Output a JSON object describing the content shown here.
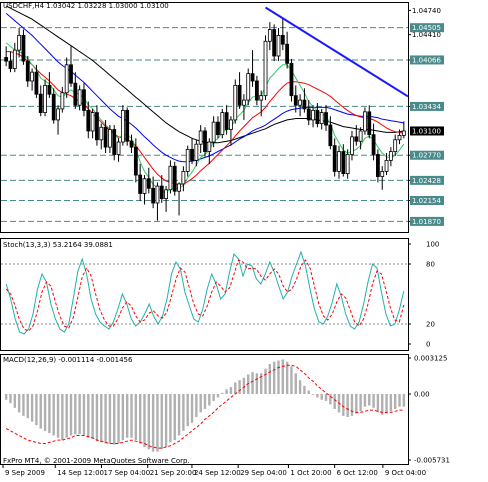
{
  "main_chart": {
    "header": "USDCHF,H4  1.03042 1.03228 1.03000 1.03100",
    "price_ticks": [
      "1.04740",
      "1.04410",
      "1.04066",
      "1.03434",
      "1.02770",
      "1.02428",
      "1.02154",
      "1.01870"
    ],
    "price_labels": [
      "1.04505",
      "1.04066",
      "1.03434",
      "1.03100",
      "1.02770",
      "1.02428",
      "1.02154",
      "1.01870"
    ],
    "current_price": "1.03100",
    "price_range": [
      1.0178,
      1.048
    ],
    "hlines": [
      1.04505,
      1.04066,
      1.03434,
      1.0277,
      1.02428,
      1.02154,
      1.0187
    ],
    "trendline": {
      "from_bar": 60,
      "from_price": 1.0478,
      "to_bar": 98,
      "to_price": 1.0366
    },
    "candles": [
      [
        1.041,
        1.0425,
        1.0398,
        1.0405
      ],
      [
        1.0405,
        1.0418,
        1.039,
        1.0395
      ],
      [
        1.0395,
        1.043,
        1.039,
        1.042
      ],
      [
        1.042,
        1.045,
        1.041,
        1.044
      ],
      [
        1.044,
        1.0448,
        1.04,
        1.0405
      ],
      [
        1.0405,
        1.0412,
        1.037,
        1.0378
      ],
      [
        1.0378,
        1.0395,
        1.0365,
        1.039
      ],
      [
        1.039,
        1.04,
        1.0355,
        1.036
      ],
      [
        1.036,
        1.0372,
        1.033,
        1.0335
      ],
      [
        1.0335,
        1.038,
        1.033,
        1.0372
      ],
      [
        1.0372,
        1.039,
        1.0355,
        1.036
      ],
      [
        1.036,
        1.0368,
        1.032,
        1.0325
      ],
      [
        1.0325,
        1.0345,
        1.0305,
        1.034
      ],
      [
        1.034,
        1.037,
        1.0335,
        1.0362
      ],
      [
        1.0362,
        1.041,
        1.0355,
        1.04
      ],
      [
        1.04,
        1.0425,
        1.037,
        1.0375
      ],
      [
        1.0375,
        1.039,
        1.034,
        1.0345
      ],
      [
        1.0345,
        1.0372,
        1.0338,
        1.0366
      ],
      [
        1.0366,
        1.0375,
        1.033,
        1.0338
      ],
      [
        1.0338,
        1.035,
        1.03,
        1.031
      ],
      [
        1.031,
        1.034,
        1.03,
        1.0335
      ],
      [
        1.0335,
        1.0345,
        1.029,
        1.0298
      ],
      [
        1.0298,
        1.032,
        1.0285,
        1.0315
      ],
      [
        1.0315,
        1.0325,
        1.028,
        1.0288
      ],
      [
        1.0288,
        1.0318,
        1.028,
        1.0312
      ],
      [
        1.0312,
        1.0318,
        1.027,
        1.0278
      ],
      [
        1.0278,
        1.03,
        1.0268,
        1.0295
      ],
      [
        1.0295,
        1.0345,
        1.029,
        1.0338
      ],
      [
        1.0338,
        1.0342,
        1.029,
        1.0296
      ],
      [
        1.0296,
        1.0305,
        1.028,
        1.0288
      ],
      [
        1.0288,
        1.03,
        1.024,
        1.025
      ],
      [
        1.025,
        1.0265,
        1.0215,
        1.0225
      ],
      [
        1.0225,
        1.025,
        1.021,
        1.0245
      ],
      [
        1.0245,
        1.026,
        1.0225,
        1.0232
      ],
      [
        1.0232,
        1.0248,
        1.0205,
        1.0212
      ],
      [
        1.0212,
        1.024,
        1.0188,
        1.0235
      ],
      [
        1.0235,
        1.025,
        1.0212,
        1.0218
      ],
      [
        1.0218,
        1.0235,
        1.02,
        1.023
      ],
      [
        1.023,
        1.027,
        1.0225,
        1.0262
      ],
      [
        1.0262,
        1.0268,
        1.0222,
        1.0228
      ],
      [
        1.0228,
        1.024,
        1.0195,
        1.0238
      ],
      [
        1.0238,
        1.0262,
        1.0228,
        1.0255
      ],
      [
        1.0255,
        1.029,
        1.0248,
        1.0285
      ],
      [
        1.0285,
        1.03,
        1.0265,
        1.027
      ],
      [
        1.027,
        1.0298,
        1.0262,
        1.0292
      ],
      [
        1.0292,
        1.0318,
        1.028,
        1.031
      ],
      [
        1.031,
        1.0315,
        1.0275,
        1.0282
      ],
      [
        1.0282,
        1.03,
        1.0265,
        1.0295
      ],
      [
        1.0295,
        1.033,
        1.0288,
        1.0322
      ],
      [
        1.0322,
        1.033,
        1.03,
        1.0305
      ],
      [
        1.0305,
        1.034,
        1.03,
        1.0335
      ],
      [
        1.0335,
        1.0345,
        1.0305,
        1.0312
      ],
      [
        1.0312,
        1.033,
        1.029,
        1.0325
      ],
      [
        1.0325,
        1.038,
        1.032,
        1.0372
      ],
      [
        1.0372,
        1.039,
        1.034,
        1.0345
      ],
      [
        1.0345,
        1.036,
        1.0325,
        1.0352
      ],
      [
        1.0352,
        1.0395,
        1.0345,
        1.0388
      ],
      [
        1.0388,
        1.042,
        1.037,
        1.0378
      ],
      [
        1.0378,
        1.0385,
        1.0345,
        1.0352
      ],
      [
        1.0352,
        1.0365,
        1.033,
        1.0358
      ],
      [
        1.0358,
        1.044,
        1.0352,
        1.0432
      ],
      [
        1.0432,
        1.0458,
        1.042,
        1.0448
      ],
      [
        1.0448,
        1.0455,
        1.0405,
        1.0412
      ],
      [
        1.0412,
        1.045,
        1.0405,
        1.044
      ],
      [
        1.044,
        1.0462,
        1.042,
        1.0428
      ],
      [
        1.0428,
        1.0445,
        1.0395,
        1.0402
      ],
      [
        1.0402,
        1.0408,
        1.035,
        1.0358
      ],
      [
        1.0358,
        1.0372,
        1.0335,
        1.0345
      ],
      [
        1.0345,
        1.036,
        1.033,
        1.0352
      ],
      [
        1.0352,
        1.0368,
        1.0335,
        1.034
      ],
      [
        1.034,
        1.0352,
        1.0318,
        1.0325
      ],
      [
        1.0325,
        1.0345,
        1.0315,
        1.0338
      ],
      [
        1.0338,
        1.0348,
        1.0315,
        1.032
      ],
      [
        1.032,
        1.034,
        1.0312,
        1.0335
      ],
      [
        1.0335,
        1.0345,
        1.031,
        1.0318
      ],
      [
        1.0318,
        1.033,
        1.0285,
        1.029
      ],
      [
        1.029,
        1.03,
        1.0248,
        1.0255
      ],
      [
        1.0255,
        1.029,
        1.0245,
        1.0282
      ],
      [
        1.0282,
        1.0292,
        1.0248,
        1.0252
      ],
      [
        1.0252,
        1.0285,
        1.0245,
        1.0278
      ],
      [
        1.0278,
        1.031,
        1.027,
        1.0302
      ],
      [
        1.0302,
        1.0318,
        1.029,
        1.0296
      ],
      [
        1.0296,
        1.0315,
        1.0285,
        1.031
      ],
      [
        1.031,
        1.0342,
        1.0305,
        1.0336
      ],
      [
        1.0336,
        1.0345,
        1.03,
        1.0305
      ],
      [
        1.0305,
        1.032,
        1.027,
        1.0278
      ],
      [
        1.0278,
        1.0285,
        1.024,
        1.0248
      ],
      [
        1.0248,
        1.0262,
        1.023,
        1.0255
      ],
      [
        1.0255,
        1.028,
        1.025,
        1.027
      ],
      [
        1.027,
        1.0288,
        1.0262,
        1.0282
      ],
      [
        1.0282,
        1.0305,
        1.0276,
        1.0298
      ],
      [
        1.0298,
        1.0312,
        1.0292,
        1.0304
      ],
      [
        1.0304,
        1.0323,
        1.03,
        1.031
      ]
    ],
    "ma_red": [
      1.0418,
      1.0418,
      1.0416,
      1.0414,
      1.041,
      1.0405,
      1.04,
      1.0394,
      1.0388,
      1.0383,
      1.0378,
      1.0372,
      1.0366,
      1.0362,
      1.036,
      1.0358,
      1.0354,
      1.035,
      1.0346,
      1.034,
      1.0334,
      1.0328,
      1.0322,
      1.0316,
      1.0311,
      1.0306,
      1.0302,
      1.03,
      1.0298,
      1.0296,
      1.029,
      1.0282,
      1.0274,
      1.0266,
      1.0258,
      1.0251,
      1.0246,
      1.0242,
      1.024,
      1.0238,
      1.0237,
      1.0238,
      1.0241,
      1.0245,
      1.025,
      1.0256,
      1.0261,
      1.0266,
      1.0272,
      1.0278,
      1.0284,
      1.029,
      1.0296,
      1.0303,
      1.031,
      1.0316,
      1.0322,
      1.0328,
      1.0332,
      1.0336,
      1.0342,
      1.035,
      1.0357,
      1.0364,
      1.037,
      1.0375,
      1.0377,
      1.0377,
      1.0376,
      1.0375,
      1.0373,
      1.037,
      1.0367,
      1.0364,
      1.0361,
      1.0357,
      1.0352,
      1.0347,
      1.0342,
      1.0338,
      1.0334,
      1.0331,
      1.0329,
      1.0328,
      1.0327,
      1.0325,
      1.0322,
      1.0318,
      1.0314,
      1.0311,
      1.0309,
      1.0308,
      1.0307
    ],
    "ma_green": [
      1.043,
      1.0425,
      1.042,
      1.0418,
      1.0415,
      1.0408,
      1.04,
      1.0393,
      1.0382,
      1.0378,
      1.0374,
      1.0366,
      1.0358,
      1.0356,
      1.0362,
      1.0366,
      1.0362,
      1.036,
      1.0355,
      1.0345,
      1.034,
      1.0332,
      1.0325,
      1.0318,
      1.0313,
      1.0305,
      1.03,
      1.0305,
      1.0305,
      1.03,
      1.0285,
      1.0268,
      1.0255,
      1.0247,
      1.0237,
      1.0233,
      1.0228,
      1.0226,
      1.0232,
      1.0232,
      1.0232,
      1.0236,
      1.0246,
      1.0254,
      1.0264,
      1.0274,
      1.0278,
      1.0284,
      1.0295,
      1.03,
      1.0308,
      1.0312,
      1.0314,
      1.0326,
      1.0332,
      1.0338,
      1.0348,
      1.0356,
      1.0358,
      1.0358,
      1.037,
      1.0382,
      1.0388,
      1.0395,
      1.04,
      1.04,
      1.0392,
      1.0382,
      1.0372,
      1.0362,
      1.035,
      1.0343,
      1.0337,
      1.0334,
      1.033,
      1.032,
      1.0304,
      1.0294,
      1.0284,
      1.028,
      1.0282,
      1.0285,
      1.029,
      1.03,
      1.0303,
      1.0298,
      1.0288,
      1.028,
      1.0275,
      1.0273,
      1.0277,
      1.0284,
      1.0292
    ],
    "ma_blue": [
      1.047,
      1.0465,
      1.046,
      1.0455,
      1.045,
      1.0445,
      1.044,
      1.0434,
      1.0428,
      1.0422,
      1.0416,
      1.041,
      1.0404,
      1.0399,
      1.0395,
      1.0391,
      1.0386,
      1.0381,
      1.0376,
      1.037,
      1.0364,
      1.0358,
      1.0352,
      1.0346,
      1.034,
      1.0335,
      1.033,
      1.0327,
      1.0323,
      1.0319,
      1.0314,
      1.0308,
      1.0302,
      1.0297,
      1.0291,
      1.0286,
      1.0281,
      1.0277,
      1.0274,
      1.0271,
      1.0269,
      1.0268,
      1.0268,
      1.0269,
      1.027,
      1.0272,
      1.0274,
      1.0276,
      1.0279,
      1.0282,
      1.0285,
      1.0288,
      1.0291,
      1.0295,
      1.0299,
      1.0302,
      1.0306,
      1.031,
      1.0313,
      1.0315,
      1.0318,
      1.0322,
      1.0326,
      1.033,
      1.0334,
      1.0337,
      1.0339,
      1.034,
      1.0341,
      1.0342,
      1.0342,
      1.0342,
      1.0342,
      1.0342,
      1.0342,
      1.0341,
      1.0339,
      1.0337,
      1.0335,
      1.0333,
      1.0332,
      1.0331,
      1.033,
      1.033,
      1.033,
      1.0329,
      1.0328,
      1.0326,
      1.0325,
      1.0324,
      1.0323,
      1.0322,
      1.0321
    ],
    "ma_black": [
      1.048,
      1.0477,
      1.0474,
      1.0471,
      1.0468,
      1.0465,
      1.0462,
      1.0458,
      1.0454,
      1.045,
      1.0446,
      1.0442,
      1.0438,
      1.0434,
      1.043,
      1.0426,
      1.0422,
      1.0418,
      1.0414,
      1.041,
      1.0406,
      1.0401,
      1.0396,
      1.0391,
      1.0386,
      1.0381,
      1.0376,
      1.0371,
      1.0366,
      1.0361,
      1.0356,
      1.0351,
      1.0346,
      1.0341,
      1.0336,
      1.0331,
      1.0326,
      1.0321,
      1.0317,
      1.0313,
      1.0309,
      1.0306,
      1.0303,
      1.03,
      1.0298,
      1.0296,
      1.0295,
      1.0294,
      1.0294,
      1.0294,
      1.0295,
      1.0296,
      1.0297,
      1.0299,
      1.0301,
      1.0303,
      1.0305,
      1.0307,
      1.0309,
      1.0311,
      1.0313,
      1.0316,
      1.0319,
      1.0321,
      1.0323,
      1.0325,
      1.0326,
      1.0327,
      1.0327,
      1.0327,
      1.0327,
      1.0326,
      1.0325,
      1.0324,
      1.0323,
      1.0322,
      1.032,
      1.0318,
      1.0316,
      1.0315,
      1.0314,
      1.0313,
      1.0312,
      1.0312,
      1.0312,
      1.0311,
      1.031,
      1.0309,
      1.0308,
      1.0308,
      1.0308,
      1.0309,
      1.031
    ]
  },
  "stoch_panel": {
    "header": "Stoch(13,3,3) 53.2164 39.0881",
    "ticks": [
      "100",
      "80",
      "20",
      "0"
    ],
    "levels": [
      80,
      20
    ],
    "main": [
      60,
      45,
      25,
      12,
      10,
      15,
      30,
      55,
      70,
      62,
      40,
      25,
      15,
      12,
      20,
      45,
      72,
      85,
      70,
      45,
      30,
      22,
      18,
      15,
      22,
      35,
      50,
      40,
      25,
      18,
      22,
      30,
      40,
      28,
      20,
      28,
      45,
      70,
      82,
      75,
      52,
      38,
      25,
      22,
      35,
      55,
      70,
      60,
      45,
      50,
      72,
      90,
      85,
      68,
      80,
      78,
      65,
      60,
      70,
      82,
      72,
      58,
      45,
      52,
      68,
      80,
      92,
      78,
      55,
      35,
      22,
      20,
      28,
      42,
      60,
      48,
      30,
      18,
      15,
      22,
      40,
      62,
      80,
      76,
      52,
      30,
      18,
      20,
      34,
      53
    ],
    "signal": [
      55,
      50,
      38,
      24,
      15,
      13,
      18,
      33,
      52,
      62,
      58,
      42,
      28,
      18,
      16,
      26,
      46,
      67,
      76,
      68,
      50,
      34,
      24,
      18,
      18,
      25,
      36,
      42,
      38,
      28,
      22,
      24,
      31,
      33,
      28,
      26,
      32,
      48,
      65,
      76,
      72,
      56,
      40,
      30,
      28,
      38,
      52,
      62,
      58,
      52,
      56,
      70,
      84,
      82,
      75,
      76,
      75,
      68,
      64,
      70,
      75,
      70,
      58,
      52,
      55,
      65,
      78,
      84,
      76,
      58,
      40,
      28,
      24,
      30,
      42,
      50,
      46,
      34,
      22,
      18,
      25,
      40,
      60,
      73,
      70,
      54,
      36,
      24,
      22,
      39
    ]
  },
  "macd_panel": {
    "header": "MACD(12,26,9) -0.001114 -0.001456",
    "ticks": [
      "0.003125",
      "0.00",
      "-0.005731"
    ],
    "range": [
      -0.005731,
      0.003125
    ],
    "hist": [
      -0.0005,
      -0.0008,
      -0.0012,
      -0.0016,
      -0.0019,
      -0.0021,
      -0.0024,
      -0.0027,
      -0.003,
      -0.0032,
      -0.0034,
      -0.0036,
      -0.0038,
      -0.004,
      -0.0038,
      -0.0036,
      -0.0035,
      -0.0035,
      -0.0036,
      -0.0038,
      -0.0039,
      -0.0041,
      -0.0042,
      -0.0043,
      -0.0043,
      -0.0044,
      -0.0043,
      -0.004,
      -0.0038,
      -0.0038,
      -0.004,
      -0.0043,
      -0.0046,
      -0.0048,
      -0.005,
      -0.005,
      -0.0048,
      -0.0046,
      -0.0042,
      -0.004,
      -0.0036,
      -0.0032,
      -0.0028,
      -0.0025,
      -0.002,
      -0.0016,
      -0.0013,
      -0.001,
      -0.0006,
      -0.0003,
      0.0001,
      0.0004,
      0.0006,
      0.001,
      0.0012,
      0.0014,
      0.0017,
      0.0019,
      0.0018,
      0.0018,
      0.0022,
      0.0026,
      0.0028,
      0.0029,
      0.003,
      0.0028,
      0.0024,
      0.0018,
      0.0012,
      0.0007,
      0.0003,
      0.0,
      -0.0003,
      -0.0005,
      -0.0006,
      -0.0009,
      -0.0013,
      -0.0016,
      -0.0019,
      -0.002,
      -0.0019,
      -0.0017,
      -0.0015,
      -0.0011,
      -0.001,
      -0.0012,
      -0.0016,
      -0.0018,
      -0.0017,
      -0.0015,
      -0.0013,
      -0.0011,
      -0.0011
    ],
    "signal": [
      -0.003,
      -0.0032,
      -0.0034,
      -0.0036,
      -0.0038,
      -0.004,
      -0.0041,
      -0.0042,
      -0.0043,
      -0.0043,
      -0.0042,
      -0.0041,
      -0.004,
      -0.004,
      -0.0039,
      -0.0038,
      -0.0036,
      -0.0036,
      -0.0036,
      -0.0037,
      -0.0038,
      -0.004,
      -0.0041,
      -0.0042,
      -0.0043,
      -0.0043,
      -0.0043,
      -0.0042,
      -0.0041,
      -0.004,
      -0.0041,
      -0.0042,
      -0.0043,
      -0.0045,
      -0.0046,
      -0.0047,
      -0.0047,
      -0.0046,
      -0.0045,
      -0.0043,
      -0.0041,
      -0.0038,
      -0.0035,
      -0.0032,
      -0.0029,
      -0.0026,
      -0.0022,
      -0.0019,
      -0.0016,
      -0.0012,
      -0.0009,
      -0.0006,
      -0.0003,
      0.0,
      0.0003,
      0.0006,
      0.0009,
      0.0011,
      0.0013,
      0.0015,
      0.0017,
      0.0019,
      0.0021,
      0.0023,
      0.0024,
      0.0025,
      0.0025,
      0.0024,
      0.0021,
      0.0018,
      0.0014,
      0.0011,
      0.0007,
      0.0004,
      0.0001,
      -0.0002,
      -0.0005,
      -0.0008,
      -0.0011,
      -0.0013,
      -0.0015,
      -0.0016,
      -0.0016,
      -0.0015,
      -0.0014,
      -0.0014,
      -0.0015,
      -0.0016,
      -0.0016,
      -0.0016,
      -0.0015,
      -0.0014,
      -0.0014
    ]
  },
  "time_axis": [
    "9 Sep 2009",
    "14 Sep 12:00",
    "17 Sep 04:00",
    "21 Sep 20:00",
    "24 Sep 12:00",
    "29 Sep 04:00",
    "1 Oct 20:00",
    "6 Oct 12:00",
    "9 Oct 04:00"
  ],
  "copyright": "FxPro MT4, © 2001-2009 MetaQuotes Software Corp.",
  "colors": {
    "bg": "#ffffff",
    "candle": "#000000",
    "grid": "#4a8a8a",
    "ma_red": "#ff0000",
    "ma_green": "#33cc66",
    "ma_blue": "#0000ff",
    "ma_black": "#000000",
    "trendline": "#1a1aff",
    "stoch_main": "#20b2aa",
    "stoch_signal": "#ff0000",
    "macd_hist": "#b0b0b0",
    "macd_signal": "#ff0000",
    "price_tag": "#000000"
  }
}
